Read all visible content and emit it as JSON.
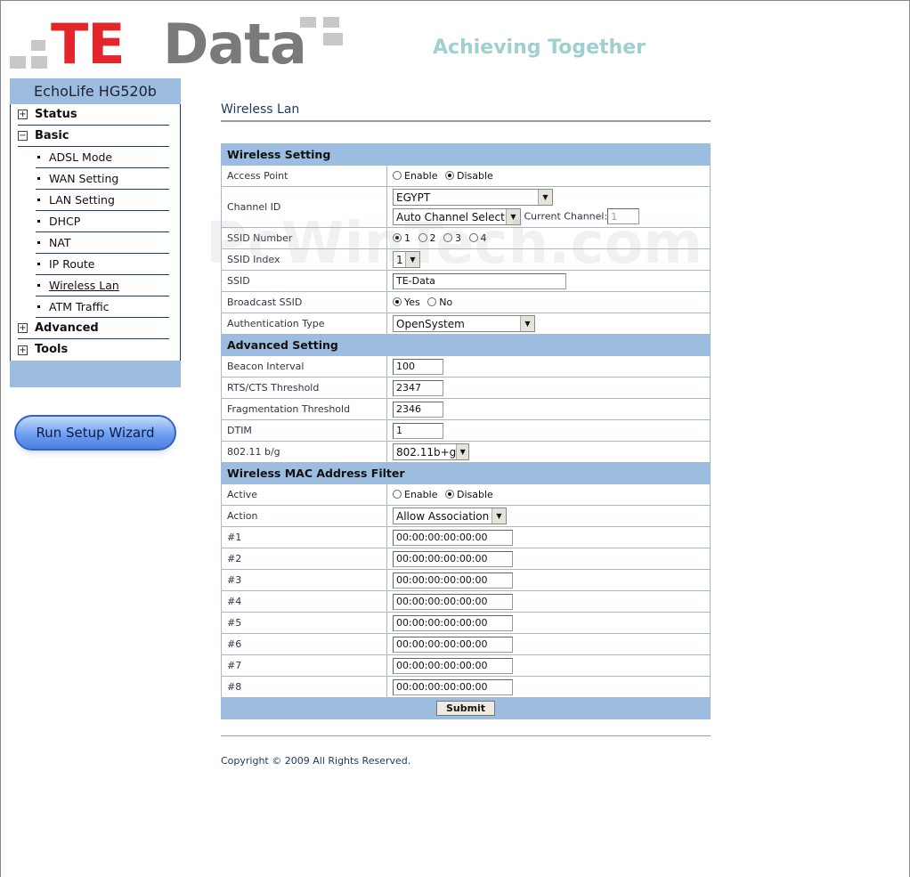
{
  "header": {
    "logo_te": "TE",
    "logo_data": "Data",
    "tagline": "Achieving Together"
  },
  "sidebar": {
    "model": "EchoLife HG520b",
    "menu": [
      {
        "label": "Status",
        "type": "group",
        "expanded": false
      },
      {
        "label": "Basic",
        "type": "group",
        "expanded": true
      },
      {
        "label": "ADSL Mode",
        "type": "item"
      },
      {
        "label": "WAN Setting",
        "type": "item"
      },
      {
        "label": "LAN Setting",
        "type": "item"
      },
      {
        "label": "DHCP",
        "type": "item"
      },
      {
        "label": "NAT",
        "type": "item"
      },
      {
        "label": "IP Route",
        "type": "item"
      },
      {
        "label": "Wireless Lan",
        "type": "item",
        "active": true
      },
      {
        "label": "ATM Traffic",
        "type": "item"
      },
      {
        "label": "Advanced",
        "type": "group",
        "expanded": false
      },
      {
        "label": "Tools",
        "type": "group",
        "expanded": false
      }
    ],
    "wizard_label": "Run Setup Wizard"
  },
  "main": {
    "title": "Wireless Lan",
    "wireless_setting": {
      "heading": "Wireless Setting",
      "access_point": {
        "label": "Access Point",
        "enable": "Enable",
        "disable": "Disable",
        "selected": "Disable"
      },
      "channel_id": {
        "label": "Channel ID",
        "country": "EGYPT",
        "channel_select": "Auto Channel Select",
        "current_channel_label": "Current Channel:",
        "current_channel": "1"
      },
      "ssid_number": {
        "label": "SSID Number",
        "options": [
          "1",
          "2",
          "3",
          "4"
        ],
        "selected": "1"
      },
      "ssid_index": {
        "label": "SSID Index",
        "value": "1"
      },
      "ssid": {
        "label": "SSID",
        "value": "TE-Data"
      },
      "broadcast_ssid": {
        "label": "Broadcast SSID",
        "yes": "Yes",
        "no": "No",
        "selected": "Yes"
      },
      "auth_type": {
        "label": "Authentication Type",
        "value": "OpenSystem"
      }
    },
    "advanced_setting": {
      "heading": "Advanced Setting",
      "beacon": {
        "label": "Beacon Interval",
        "value": "100"
      },
      "rts": {
        "label": "RTS/CTS Threshold",
        "value": "2347"
      },
      "frag": {
        "label": "Fragmentation Threshold",
        "value": "2346"
      },
      "dtim": {
        "label": "DTIM",
        "value": "1"
      },
      "mode": {
        "label": "802.11 b/g",
        "value": "802.11b+g"
      }
    },
    "mac_filter": {
      "heading": "Wireless MAC Address Filter",
      "active": {
        "label": "Active",
        "enable": "Enable",
        "disable": "Disable",
        "selected": "Disable"
      },
      "action": {
        "label": "Action",
        "value": "Allow Association"
      },
      "entries": [
        {
          "label": "#1",
          "value": "00:00:00:00:00:00"
        },
        {
          "label": "#2",
          "value": "00:00:00:00:00:00"
        },
        {
          "label": "#3",
          "value": "00:00:00:00:00:00"
        },
        {
          "label": "#4",
          "value": "00:00:00:00:00:00"
        },
        {
          "label": "#5",
          "value": "00:00:00:00:00:00"
        },
        {
          "label": "#6",
          "value": "00:00:00:00:00:00"
        },
        {
          "label": "#7",
          "value": "00:00:00:00:00:00"
        },
        {
          "label": "#8",
          "value": "00:00:00:00:00:00"
        }
      ]
    },
    "submit_label": "Submit",
    "copyright": "Copyright © 2009 All Rights Reserved."
  },
  "watermark": "PcWinTech.com"
}
